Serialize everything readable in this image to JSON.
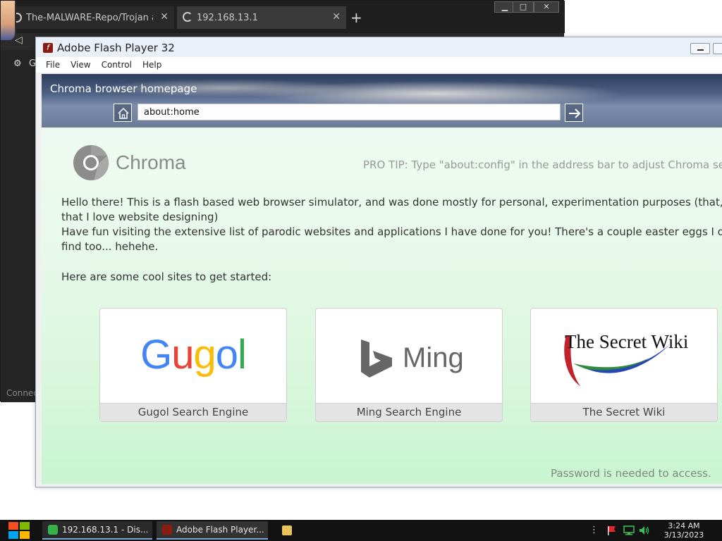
{
  "background_browser": {
    "tab1_title": "The-MALWARE-Repo/Trojan at",
    "tab2_title": "192.168.13.1",
    "tab_close": "✕",
    "new_tab": "+",
    "controls": [
      "▁",
      "□",
      "✕"
    ],
    "panel_letter": "G",
    "status": "Connec"
  },
  "flash_window": {
    "title": "Adobe Flash Player 32",
    "menu": [
      "File",
      "View",
      "Control",
      "Help"
    ]
  },
  "chroma": {
    "header_title": "Chroma browser homepage",
    "address_value": "about:home",
    "brand": "Chroma",
    "pro_tip": "PRO TIP: Type \"about:config\" in the address bar to adjust Chroma settings",
    "intro_line1": "Hello there! This is a flash based web browser simulator, and was done mostly for personal, experimentation purposes (that, and the fact",
    "intro_line1b": "that I love website designing)",
    "intro_line2": "Have fun visiting the extensive list of parodic websites and applications I have done for you! There's a couple easter eggs I dare you to",
    "intro_line2b": "find too... hehehe.",
    "intro_line3": "Here are some cool sites to get started:",
    "cards": [
      {
        "logo_text": "Gugol",
        "label": "Gugol Search Engine"
      },
      {
        "logo_text": "Ming",
        "label": "Ming Search Engine"
      },
      {
        "logo_text": "The Secret Wiki",
        "label": "The Secret Wiki"
      }
    ],
    "wiki_note": "Password is needed to access."
  },
  "taskbar": {
    "task_remote": "192.168.13.1 - Dis...",
    "task_flash": "Adobe Flash Player...",
    "tray_more": "⋮",
    "time": "3:24 AM",
    "date": "3/13/2023"
  },
  "colors": {
    "gugol": [
      "#4285F4",
      "#EA4335",
      "#FBBC05",
      "#4285F4",
      "#34A853",
      "#EA4335"
    ],
    "ming": "#666666",
    "chroma_bg": "#d8f7dc",
    "taskbar": "#121212"
  }
}
